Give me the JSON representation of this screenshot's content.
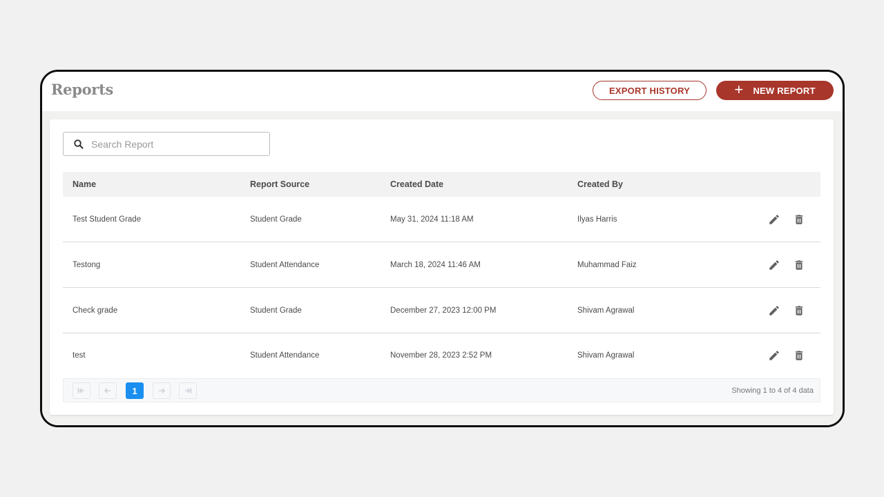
{
  "header": {
    "title": "Reports",
    "export_label": "EXPORT HISTORY",
    "new_label": "NEW REPORT",
    "accent": "#a8362b"
  },
  "search": {
    "placeholder": "Search Report",
    "value": ""
  },
  "table": {
    "columns": [
      "Name",
      "Report Source",
      "Created Date",
      "Created By"
    ],
    "rows": [
      {
        "name": "Test Student Grade",
        "source": "Student Grade",
        "date": "May 31, 2024 11:18 AM",
        "by": "Ilyas Harris"
      },
      {
        "name": "Testong",
        "source": "Student Attendance",
        "date": "March 18, 2024 11:46 AM",
        "by": "Muhammad Faiz"
      },
      {
        "name": "Check grade",
        "source": "Student Grade",
        "date": "December 27, 2023 12:00 PM",
        "by": "Shivam Agrawal"
      },
      {
        "name": "test",
        "source": "Student Attendance",
        "date": "November 28, 2023 2:52 PM",
        "by": "Shivam Agrawal"
      }
    ]
  },
  "pagination": {
    "current_page": "1",
    "showing": "Showing 1 to 4 of 4 data",
    "active_color": "#1a8ff0"
  }
}
